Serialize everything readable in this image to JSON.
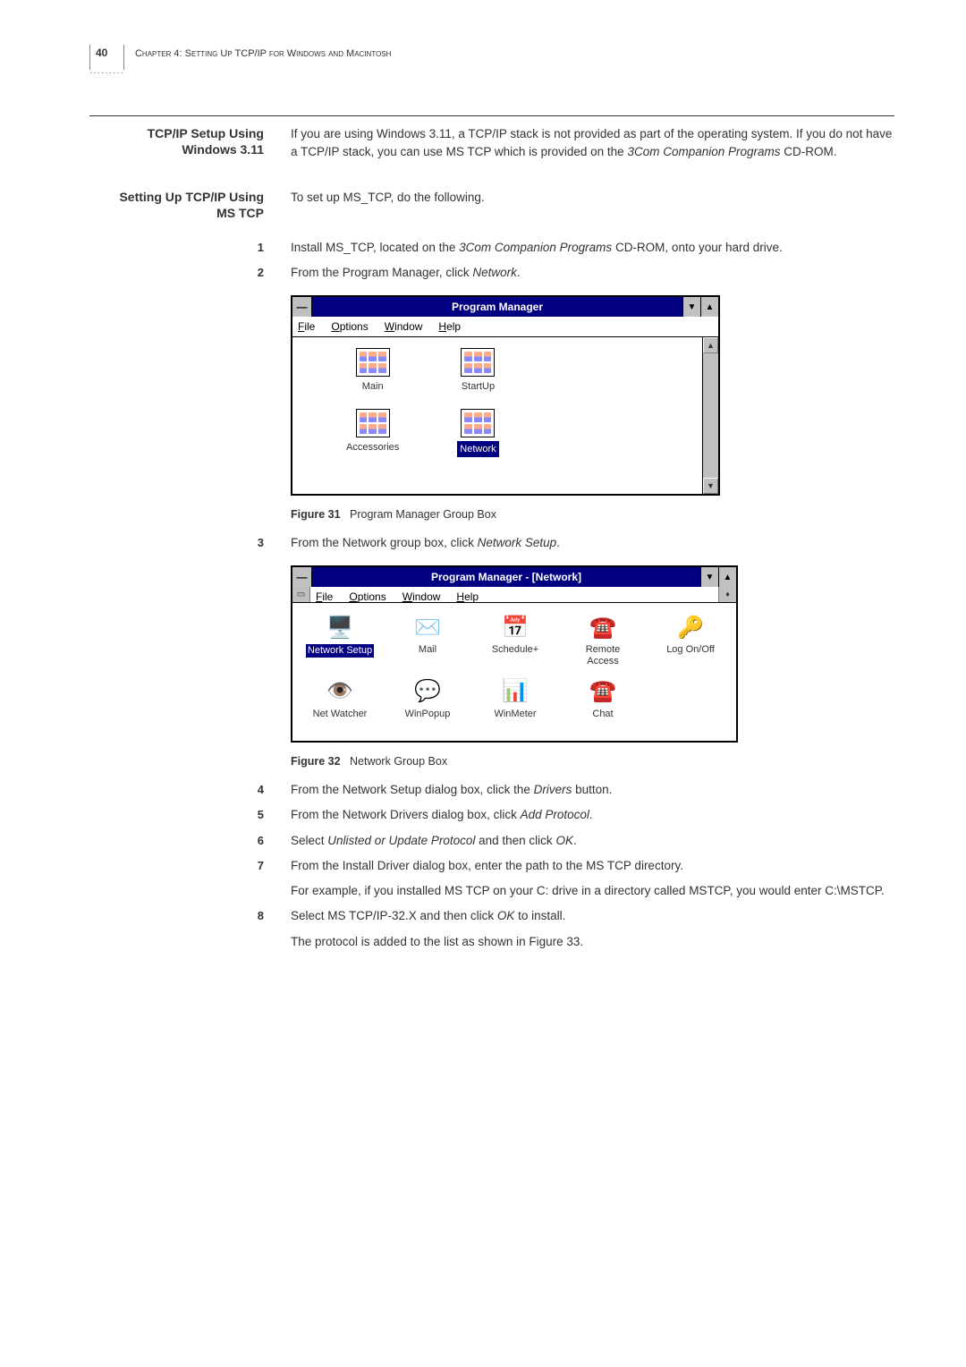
{
  "header": {
    "page_number": "40",
    "chapter": "Chapter 4: Setting Up TCP/IP for Windows and Macintosh"
  },
  "section1": {
    "heading_line1": "TCP/IP Setup Using",
    "heading_line2": "Windows 3.11",
    "body": "If you are using Windows 3.11, a TCP/IP stack is not provided as part of the operating system. If you do not have a TCP/IP stack, you can use MS TCP which is provided on the ",
    "body_italic": "3Com Companion Programs",
    "body_tail": " CD-ROM."
  },
  "section2": {
    "heading_line1": "Setting Up TCP/IP Using",
    "heading_line2": "MS TCP",
    "body": "To set up MS_TCP, do the following."
  },
  "steps": {
    "s1a": "Install MS_TCP, located on the ",
    "s1b": "3Com Companion Programs",
    "s1c": " CD-ROM, onto your hard drive.",
    "s2a": "From the Program Manager, click ",
    "s2b": "Network",
    "s2c": ".",
    "s3a": "From the Network group box, click ",
    "s3b": "Network Setup",
    "s3c": ".",
    "s4a": "From the Network Setup dialog box, click the ",
    "s4b": "Drivers",
    "s4c": " button.",
    "s5a": "From the Network Drivers dialog box, click ",
    "s5b": "Add Protocol",
    "s5c": ".",
    "s6a": "Select ",
    "s6b": "Unlisted or Update Protocol",
    "s6c": " and then click ",
    "s6d": "OK",
    "s6e": ".",
    "s7a": "From the Install Driver dialog box, enter the path to the MS TCP directory.",
    "s7b": "For example, if you installed MS TCP on your C: drive in a directory called MSTCP, you would enter C:\\MSTCP.",
    "s8a": "Select MS TCP/IP-32.X and then click ",
    "s8b": "OK",
    "s8c": " to install.",
    "s8d": "The protocol is added to the list as shown in Figure 33."
  },
  "window1": {
    "title": "Program Manager",
    "menu": {
      "file": "File",
      "options": "Options",
      "window": "Window",
      "help": "Help"
    },
    "groups": {
      "main": "Main",
      "startup": "StartUp",
      "accessories": "Accessories",
      "network": "Network"
    }
  },
  "window2": {
    "title": "Program Manager - [Network]",
    "menu": {
      "file": "File",
      "options": "Options",
      "window": "Window",
      "help": "Help"
    },
    "icons": {
      "network_setup": "Network Setup",
      "mail": "Mail",
      "schedule": "Schedule+",
      "remote_access_l1": "Remote",
      "remote_access_l2": "Access",
      "log": "Log On/Off",
      "netwatcher": "Net Watcher",
      "winpopup": "WinPopup",
      "winmeter": "WinMeter",
      "chat": "Chat"
    }
  },
  "captions": {
    "fig31_num": "Figure 31",
    "fig31_text": "Program Manager Group Box",
    "fig32_num": "Figure 32",
    "fig32_text": "Network Group Box"
  },
  "nums": {
    "n1": "1",
    "n2": "2",
    "n3": "3",
    "n4": "4",
    "n5": "5",
    "n6": "6",
    "n7": "7",
    "n8": "8"
  }
}
